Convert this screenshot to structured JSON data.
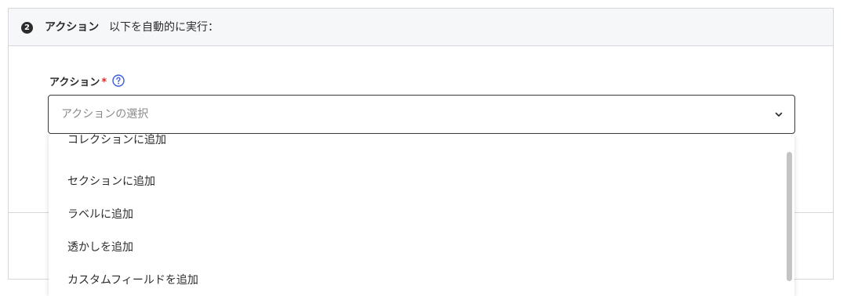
{
  "step": {
    "number": "2",
    "title": "アクション",
    "description": "以下を自動的に実行："
  },
  "field": {
    "label": "アクション",
    "required_mark": "*",
    "help_icon": "question-circle-icon"
  },
  "select": {
    "placeholder": "アクションの選択",
    "chevron_icon": "chevron-down-icon"
  },
  "dropdown": {
    "items": [
      "コレクションに追加",
      "セクションに追加",
      "ラベルに追加",
      "透かしを追加",
      "カスタムフィールドを追加"
    ]
  },
  "colors": {
    "help_icon": "#3b5bdb",
    "required": "#d93025"
  }
}
